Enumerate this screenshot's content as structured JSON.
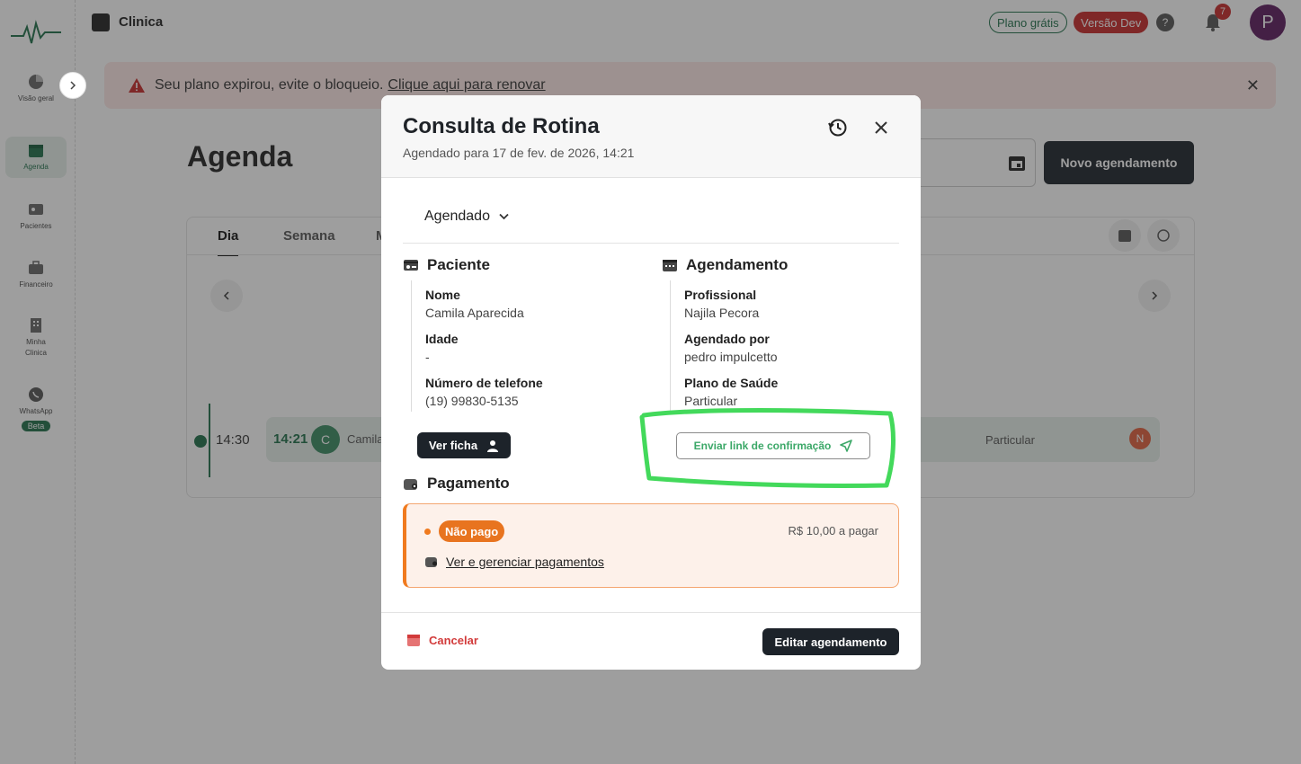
{
  "app": {
    "name": "Clinica",
    "badges": {
      "free_plan": "Plano grátis",
      "dev_version": "Versão Dev"
    },
    "help_label": "?",
    "notifications_count": "7",
    "user_initial": "P"
  },
  "sidebar": {
    "items": [
      {
        "label": "Visão geral",
        "icon": "pie-chart-icon"
      },
      {
        "label": "Agenda",
        "icon": "calendar-icon"
      },
      {
        "label": "Pacientes",
        "icon": "id-card-icon"
      },
      {
        "label": "Financeiro",
        "icon": "briefcase-icon"
      },
      {
        "label": "Minha Clinica",
        "icon": "building-icon"
      },
      {
        "label": "WhatsApp",
        "icon": "whatsapp-icon",
        "badge": "Beta"
      }
    ]
  },
  "alert": {
    "message": "Seu plano expirou, evite o bloqueio.",
    "link": "Clique aqui para renovar"
  },
  "page": {
    "title": "Agenda",
    "new_button": "Novo agendamento",
    "tabs": [
      "Dia",
      "Semana",
      "M"
    ],
    "timeline_time": "14:30",
    "appointment": {
      "time": "14:21",
      "initial": "C",
      "name": "Camila",
      "plan": "Particular",
      "professional_initial": "N"
    }
  },
  "modal": {
    "title": "Consulta de Rotina",
    "subtitle": "Agendado para 17 de fev. de 2026, 14:21",
    "status": "Agendado",
    "patient": {
      "heading": "Paciente",
      "fields": [
        {
          "label": "Nome",
          "value": "Camila Aparecida"
        },
        {
          "label": "Idade",
          "value": "-"
        },
        {
          "label": "Número de telefone",
          "value": "(19) 99830-5135"
        }
      ],
      "view_button": "Ver ficha"
    },
    "schedule": {
      "heading": "Agendamento",
      "fields": [
        {
          "label": "Profissional",
          "value": "Najila Pecora"
        },
        {
          "label": "Agendado por",
          "value": "pedro impulcetto"
        },
        {
          "label": "Plano de Saúde",
          "value": "Particular"
        }
      ],
      "confirm_button": "Enviar link de confirmação"
    },
    "payment": {
      "heading": "Pagamento",
      "status_badge": "Não pago",
      "amount": "R$ 10,00 a pagar",
      "manage_link": "Ver e gerenciar pagamentos"
    },
    "footer": {
      "cancel": "Cancelar",
      "edit": "Editar agendamento"
    }
  },
  "colors": {
    "brand_green": "#1f6f4a",
    "danger": "#c62828",
    "payment_orange": "#f07a1e",
    "highlight_green": "#43d95b"
  }
}
